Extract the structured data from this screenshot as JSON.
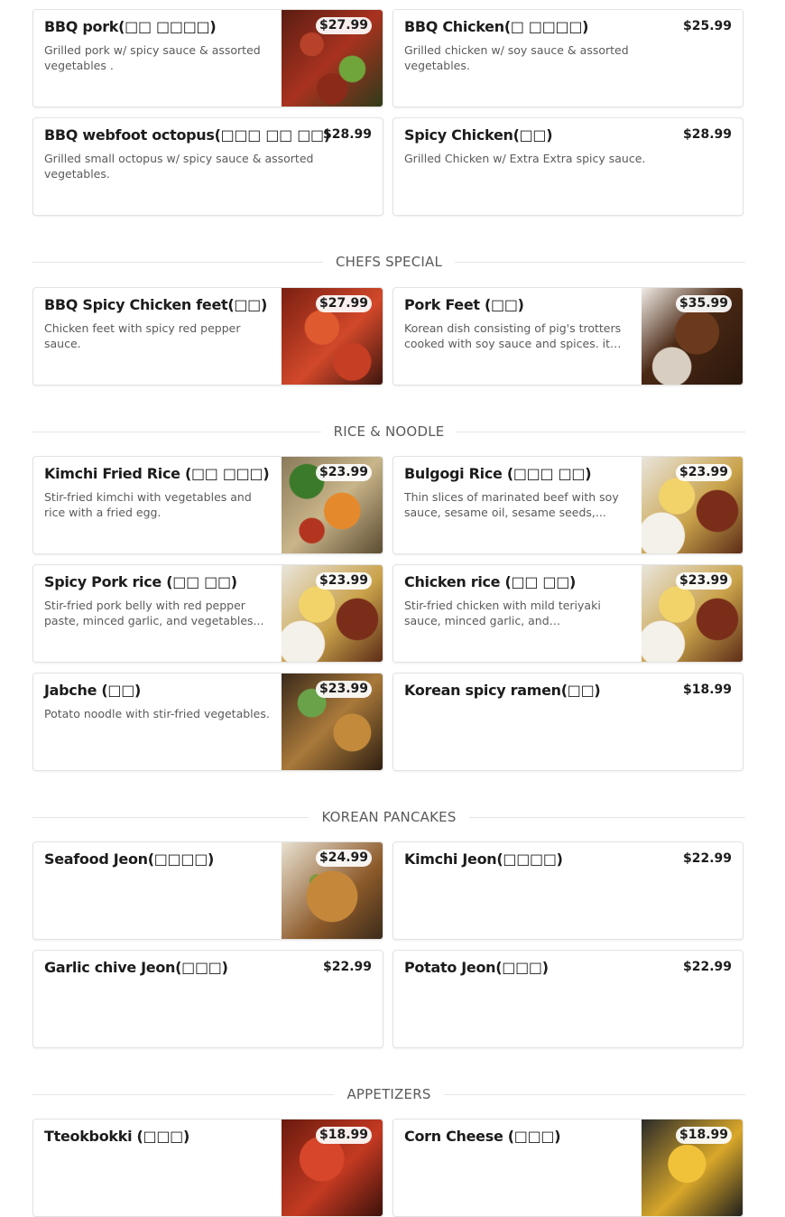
{
  "menu_top": [
    {
      "name": "BBQ pork(□□ □□□□)",
      "desc": "Grilled pork w/ spicy sauce & assorted vegetables .",
      "price": "$27.99",
      "image": "spicy-pork"
    },
    {
      "name": "BBQ Chicken(□ □□□□)",
      "desc": "Grilled chicken w/ soy sauce & assorted vegetables.",
      "price": "$25.99",
      "image": ""
    },
    {
      "name": "BBQ webfoot octopus(□□□ □□ □□)",
      "desc": "Grilled small octopus w/ spicy sauce & assorted vegetables.",
      "price": "$28.99",
      "image": ""
    },
    {
      "name": "Spicy Chicken(□□)",
      "desc": "Grilled Chicken w/ Extra Extra spicy sauce.",
      "price": "$28.99",
      "image": ""
    }
  ],
  "sections": [
    {
      "title": "CHEFS SPECIAL",
      "items": [
        {
          "name": "BBQ Spicy Chicken feet(□□)",
          "desc": "Chicken feet with spicy red pepper sauce.",
          "price": "$27.99"
        },
        {
          "name": "Pork Feet (□□)",
          "desc": "Korean dish consisting of pig's trotters cooked with soy sauce and spices. it is...",
          "price": "$35.99"
        }
      ]
    },
    {
      "title": "RICE & NOODLE",
      "items": [
        {
          "name": "Kimchi Fried Rice (□□ □□□)",
          "desc": "Stir-fried kimchi with vegetables and rice with a fried egg.",
          "price": "$23.99"
        },
        {
          "name": "Bulgogi Rice (□□□ □□)",
          "desc": "Thin slices of marinated beef with soy sauce, sesame oil, sesame seeds,...",
          "price": "$23.99"
        },
        {
          "name": "Spicy Pork rice (□□ □□)",
          "desc": "Stir-fried pork belly with red pepper paste, minced garlic, and vegetables...",
          "price": "$23.99"
        },
        {
          "name": "Chicken rice (□□ □□)",
          "desc": "Stir-fried chicken with mild teriyaki sauce, minced garlic, and vegetables...",
          "price": "$23.99"
        },
        {
          "name": "Jabche (□□)",
          "desc": "Potato noodle with stir-fried vegetables.",
          "price": "$23.99"
        },
        {
          "name": "Korean spicy ramen(□□)",
          "desc": "",
          "price": "$18.99"
        }
      ]
    },
    {
      "title": "KOREAN PANCAKES",
      "items": [
        {
          "name": "Seafood Jeon(□□□□)",
          "desc": "",
          "price": "$24.99"
        },
        {
          "name": "Kimchi Jeon(□□□□)",
          "desc": "",
          "price": "$22.99"
        },
        {
          "name": "Garlic chive Jeon(□□□)",
          "desc": "",
          "price": "$22.99"
        },
        {
          "name": "Potato Jeon(□□□)",
          "desc": "",
          "price": "$22.99"
        }
      ]
    },
    {
      "title": "APPETIZERS",
      "items": [
        {
          "name": "Tteokbokki (□□□)",
          "desc": "",
          "price": "$18.99"
        },
        {
          "name": "Corn Cheese (□□□)",
          "desc": "",
          "price": "$18.99"
        }
      ]
    }
  ]
}
